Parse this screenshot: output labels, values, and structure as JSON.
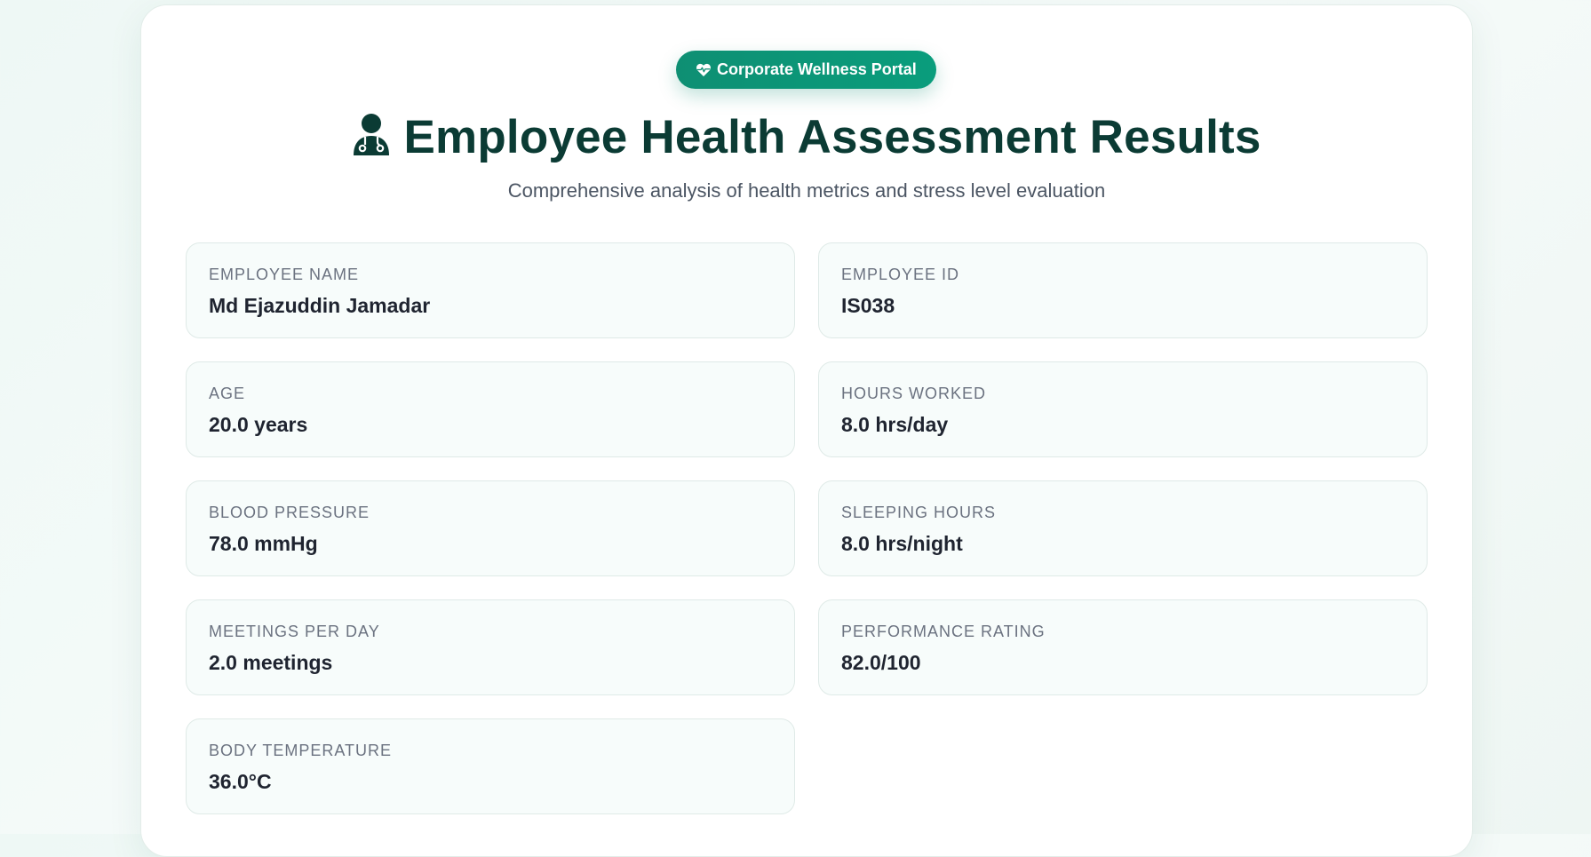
{
  "badge": {
    "icon": "heart-pulse-icon",
    "label": "Corporate Wellness Portal"
  },
  "header": {
    "icon": "user-doctor-icon",
    "title": "Employee Health Assessment Results",
    "subtitle": "Comprehensive analysis of health metrics and stress level evaluation"
  },
  "fields": [
    {
      "label": "EMPLOYEE NAME",
      "value": "Md Ejazuddin Jamadar"
    },
    {
      "label": "EMPLOYEE ID",
      "value": "IS038"
    },
    {
      "label": "AGE",
      "value": "20.0 years"
    },
    {
      "label": "HOURS WORKED",
      "value": "8.0 hrs/day"
    },
    {
      "label": "BLOOD PRESSURE",
      "value": "78.0 mmHg"
    },
    {
      "label": "SLEEPING HOURS",
      "value": "8.0 hrs/night"
    },
    {
      "label": "MEETINGS PER DAY",
      "value": "2.0 meetings"
    },
    {
      "label": "PERFORMANCE RATING",
      "value": "82.0/100"
    },
    {
      "label": "BODY TEMPERATURE",
      "value": "36.0°C"
    }
  ],
  "colors": {
    "accent": "#0e8f73",
    "title": "#0b3b34",
    "field_background": "#f7fcfb"
  }
}
